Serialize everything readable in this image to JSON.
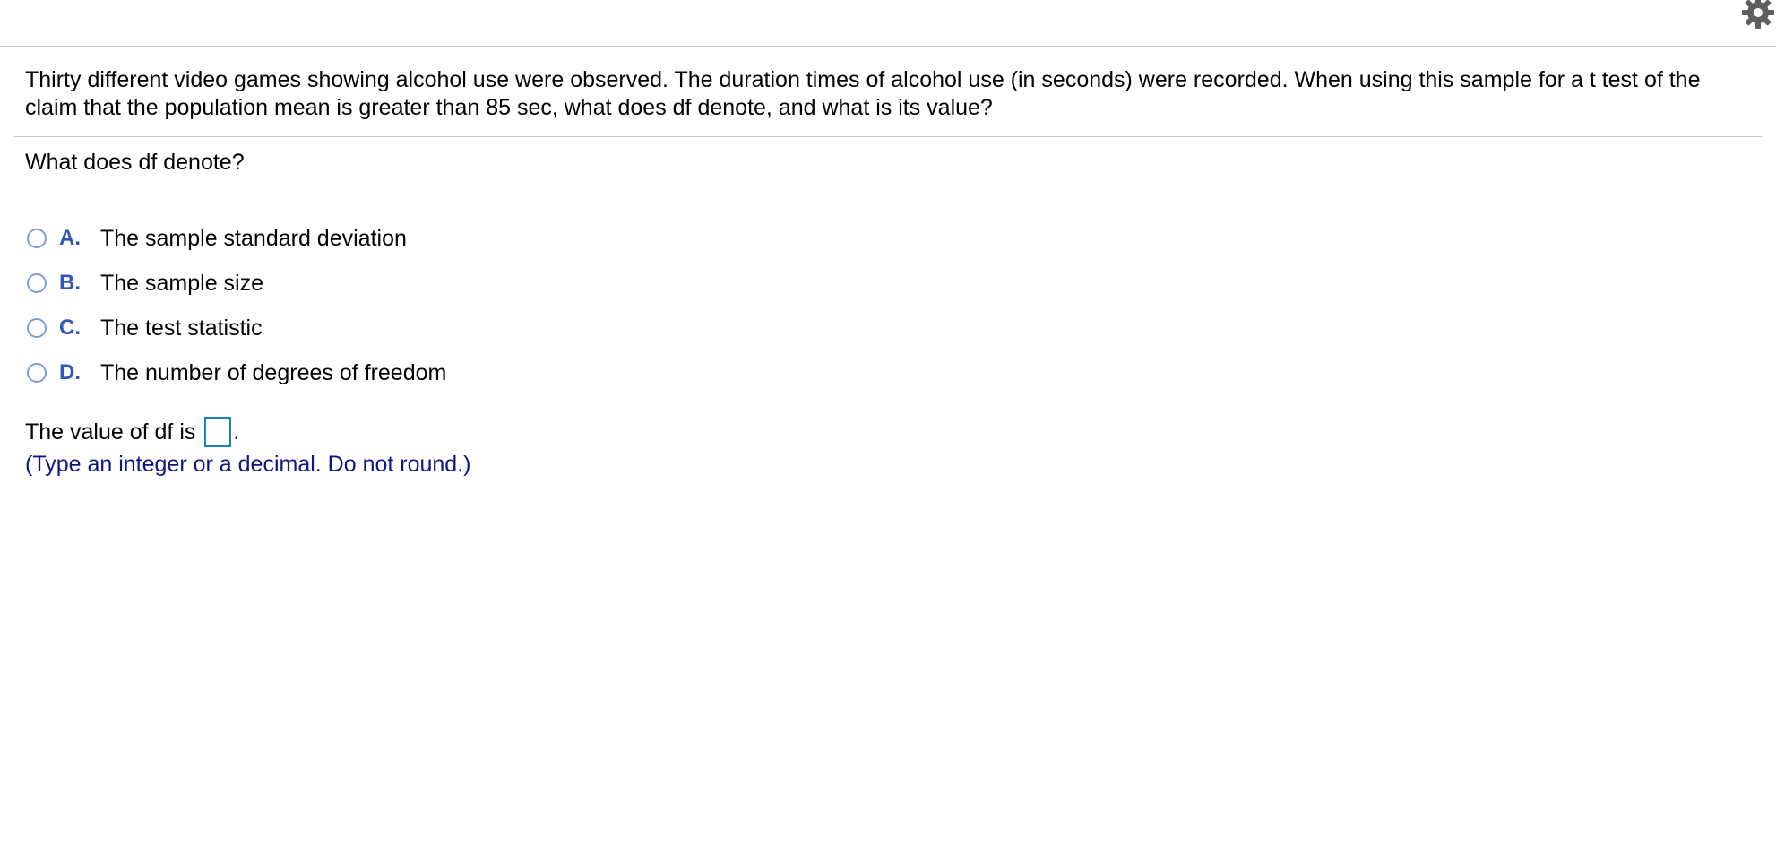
{
  "question": {
    "text": "Thirty different video games showing alcohol use were observed. The duration times of alcohol use (in seconds) were recorded. When using this sample for a t test of the claim that the population mean is greater than 85 sec, what does df denote, and what is its value?"
  },
  "subquestion": "What does df denote?",
  "options": [
    {
      "letter": "A.",
      "text": "The sample standard deviation"
    },
    {
      "letter": "B.",
      "text": "The sample size"
    },
    {
      "letter": "C.",
      "text": "The test statistic"
    },
    {
      "letter": "D.",
      "text": "The number of degrees of freedom"
    }
  ],
  "value_prompt": {
    "prefix": "The value of df is",
    "suffix": ".",
    "input_value": ""
  },
  "hint": "(Type an integer or a decimal. Do not round.)",
  "icons": {
    "settings": "gear-icon"
  },
  "colors": {
    "option_letter": "#2f56b8",
    "radio_border": "#7f9ed8",
    "input_border": "#1a82c4",
    "hint_text": "#10167f"
  }
}
